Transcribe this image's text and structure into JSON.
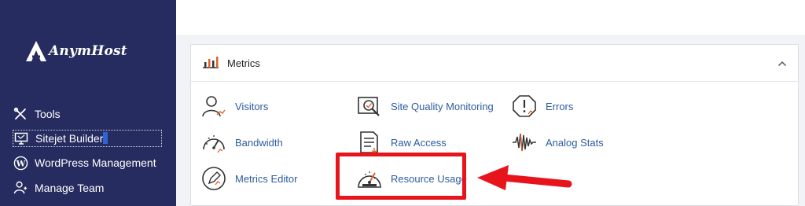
{
  "sidebar": {
    "brand": "AnymHost",
    "items": [
      {
        "label": "Tools",
        "icon": "tools-icon"
      },
      {
        "label": "Sitejet Builder",
        "icon": "monitor-icon",
        "focused": true
      },
      {
        "label": "WordPress Management",
        "icon": "wordpress-icon"
      },
      {
        "label": "Manage Team",
        "icon": "team-icon"
      }
    ]
  },
  "panel": {
    "title": "Metrics",
    "icon": "bar-chart-icon",
    "collapsed": false
  },
  "metrics": [
    {
      "label": "Visitors",
      "icon": "visitors-icon"
    },
    {
      "label": "Site Quality Monitoring",
      "icon": "site-quality-icon"
    },
    {
      "label": "Errors",
      "icon": "errors-icon"
    },
    {
      "label": "Bandwidth",
      "icon": "bandwidth-icon"
    },
    {
      "label": "Raw Access",
      "icon": "raw-access-icon"
    },
    {
      "label": "Analog Stats",
      "icon": "analog-stats-icon"
    },
    {
      "label": "Metrics Editor",
      "icon": "metrics-editor-icon"
    },
    {
      "label": "Resource Usage",
      "icon": "resource-usage-icon",
      "highlighted": true
    }
  ],
  "colors": {
    "sidebar_bg": "#262c5f",
    "link": "#2d5c9e",
    "highlight": "#e8141c",
    "icon_accent": "#e0622a"
  }
}
